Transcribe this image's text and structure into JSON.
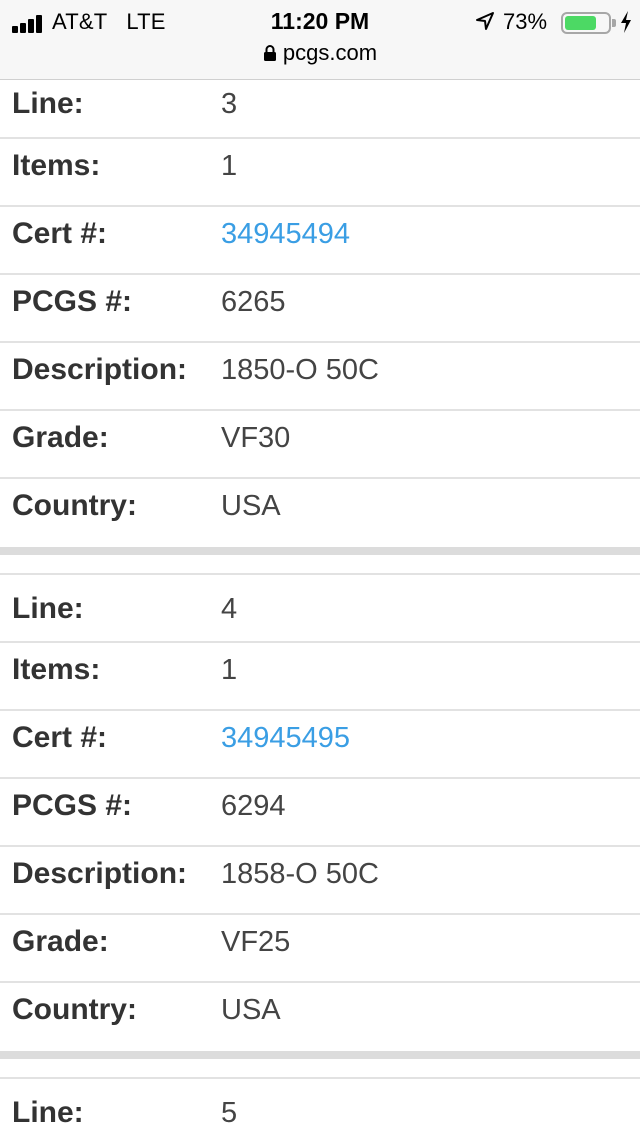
{
  "status_bar": {
    "carrier": "AT&T",
    "network": "LTE",
    "time": "11:20 PM",
    "battery_percent_label": "73%",
    "battery_level": 0.73,
    "url": "pcgs.com"
  },
  "records": [
    {
      "fields": [
        {
          "label": "Line:",
          "value": "3"
        },
        {
          "label": "Items:",
          "value": "1"
        },
        {
          "label": "Cert #:",
          "value": "34945494"
        },
        {
          "label": "PCGS #:",
          "value": "6265"
        },
        {
          "label": "Description:",
          "value": "1850-O 50C"
        },
        {
          "label": "Grade:",
          "value": "VF30"
        },
        {
          "label": "Country:",
          "value": "USA"
        }
      ]
    },
    {
      "fields": [
        {
          "label": "Line:",
          "value": "4"
        },
        {
          "label": "Items:",
          "value": "1"
        },
        {
          "label": "Cert #:",
          "value": "34945495"
        },
        {
          "label": "PCGS #:",
          "value": "6294"
        },
        {
          "label": "Description:",
          "value": "1858-O 50C"
        },
        {
          "label": "Grade:",
          "value": "VF25"
        },
        {
          "label": "Country:",
          "value": "USA"
        }
      ]
    },
    {
      "fields": [
        {
          "label": "Line:",
          "value": "5"
        }
      ]
    }
  ],
  "colors": {
    "link": "#3a9ee4",
    "battery": "#4cd964",
    "separator": "#dcdcdc"
  }
}
